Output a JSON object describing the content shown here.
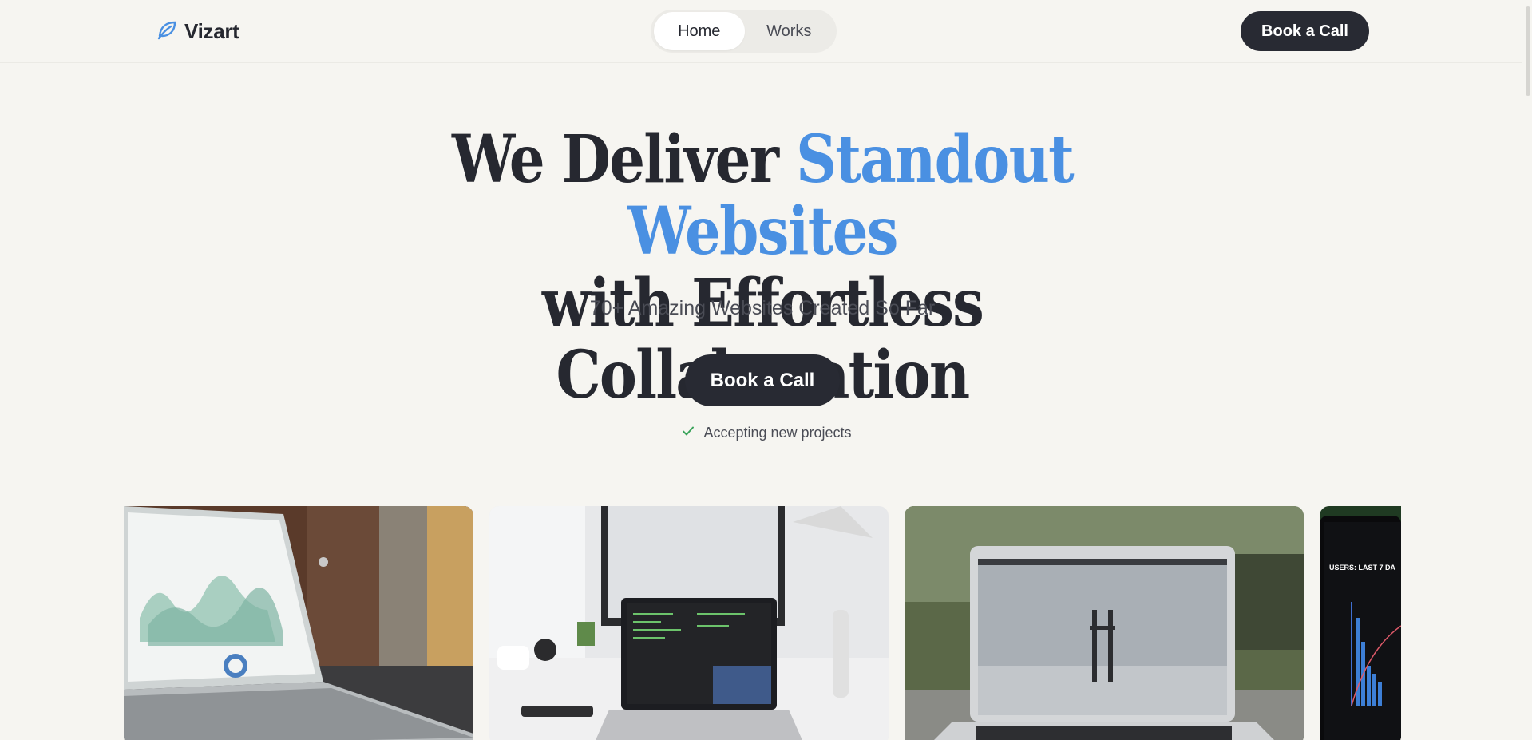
{
  "brand": {
    "name": "Vizart",
    "accent": "#4a90e2",
    "dark": "#282a33",
    "background": "#f6f5f1"
  },
  "nav": {
    "items": [
      {
        "label": "Home",
        "active": true
      },
      {
        "label": "Works",
        "active": false
      }
    ]
  },
  "header": {
    "cta_label": "Book a Call"
  },
  "hero": {
    "title_part1": "We Deliver ",
    "title_accent": "Standout Websites",
    "title_line2": "with Effortless Collaboration",
    "subtitle": "70+ Amazing Websites Created So Far",
    "cta_label": "Book a Call",
    "status_text": "Accepting new projects",
    "status_icon": "check-icon",
    "status_color": "#3aa35a"
  },
  "gallery": {
    "images": [
      {
        "name": "laptop-dashboard-image"
      },
      {
        "name": "laptop-code-desk-image"
      },
      {
        "name": "laptop-fog-bridge-image"
      },
      {
        "name": "phone-analytics-image",
        "text": "USERS: LAST 7 DA"
      }
    ]
  }
}
